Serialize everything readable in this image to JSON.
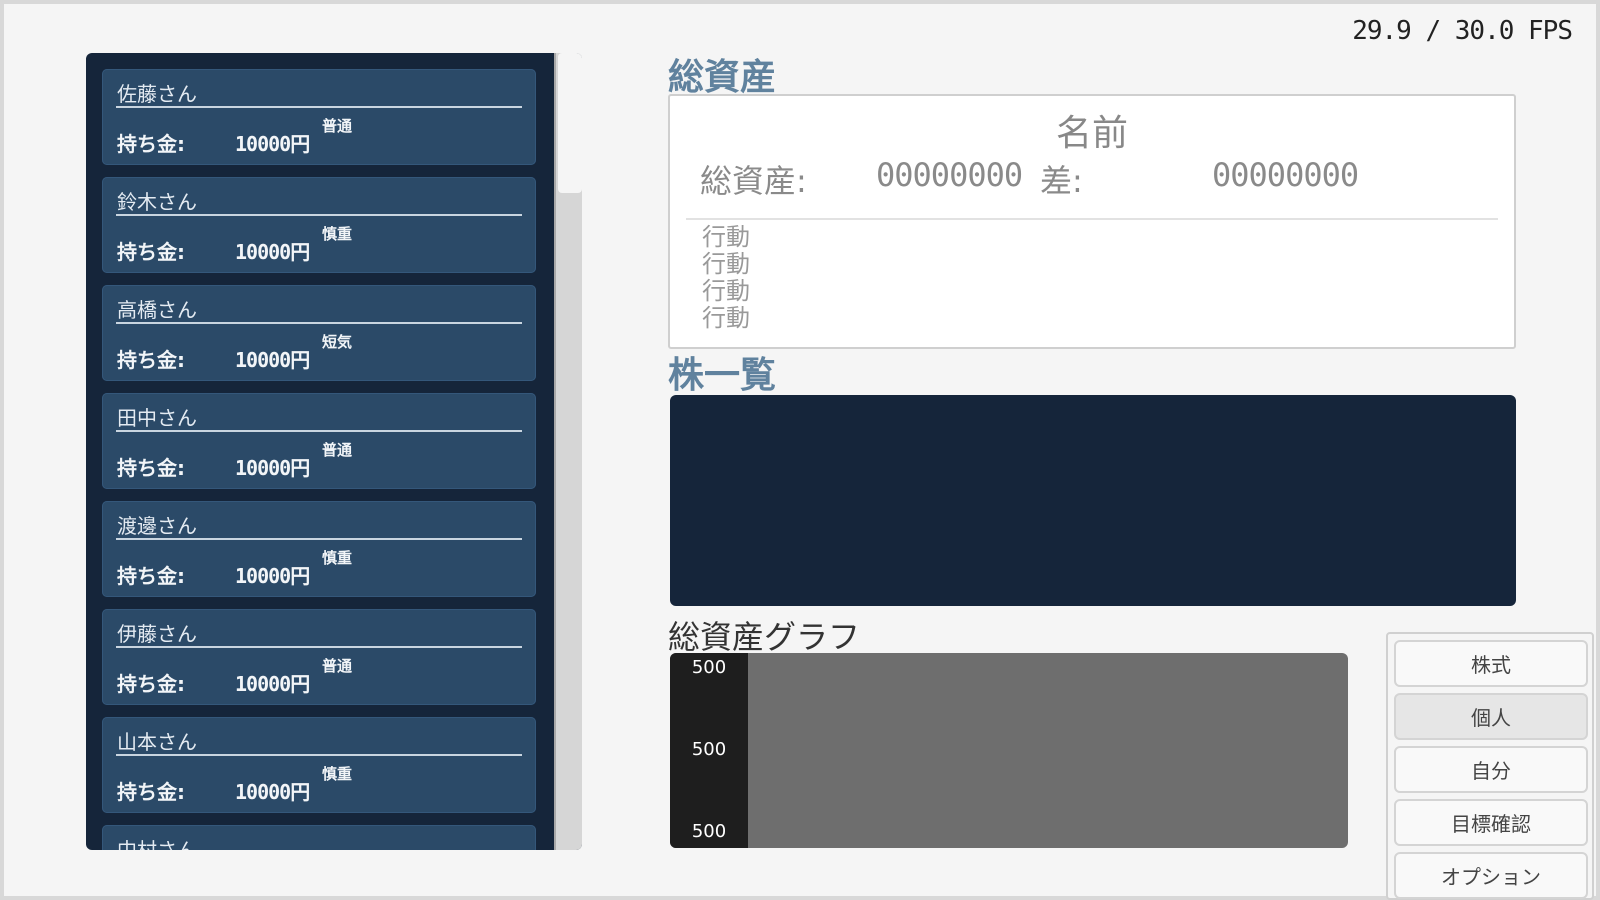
{
  "fps": "29.9 / 30.0 FPS",
  "people": [
    {
      "name": "佐藤さん",
      "money_label": "持ち金:",
      "money": "10000円",
      "personality": "普通"
    },
    {
      "name": "鈴木さん",
      "money_label": "持ち金:",
      "money": "10000円",
      "personality": "慎重"
    },
    {
      "name": "高橋さん",
      "money_label": "持ち金:",
      "money": "10000円",
      "personality": "短気"
    },
    {
      "name": "田中さん",
      "money_label": "持ち金:",
      "money": "10000円",
      "personality": "普通"
    },
    {
      "name": "渡邊さん",
      "money_label": "持ち金:",
      "money": "10000円",
      "personality": "慎重"
    },
    {
      "name": "伊藤さん",
      "money_label": "持ち金:",
      "money": "10000円",
      "personality": "普通"
    },
    {
      "name": "山本さん",
      "money_label": "持ち金:",
      "money": "10000円",
      "personality": "慎重"
    },
    {
      "name": "中村さん",
      "money_label": "",
      "money": "",
      "personality": ""
    }
  ],
  "assets": {
    "title": "総資産",
    "name": "名前",
    "total_label": "総資産:",
    "total_value": "00000000",
    "diff_label": "差:",
    "diff_value": "00000000",
    "actions": [
      "行動",
      "行動",
      "行動",
      "行動"
    ]
  },
  "stocks": {
    "title": "株一覧"
  },
  "graph": {
    "title": "総資産グラフ",
    "ticks": [
      "500",
      "500",
      "500"
    ]
  },
  "menu": {
    "stocks": "株式",
    "individual": "個人",
    "self": "自分",
    "goal_check": "目標確認",
    "options": "オプション"
  },
  "colors": {
    "panel_dark": "#15253a",
    "card": "#2b4a68",
    "section_title": "#60829e"
  }
}
